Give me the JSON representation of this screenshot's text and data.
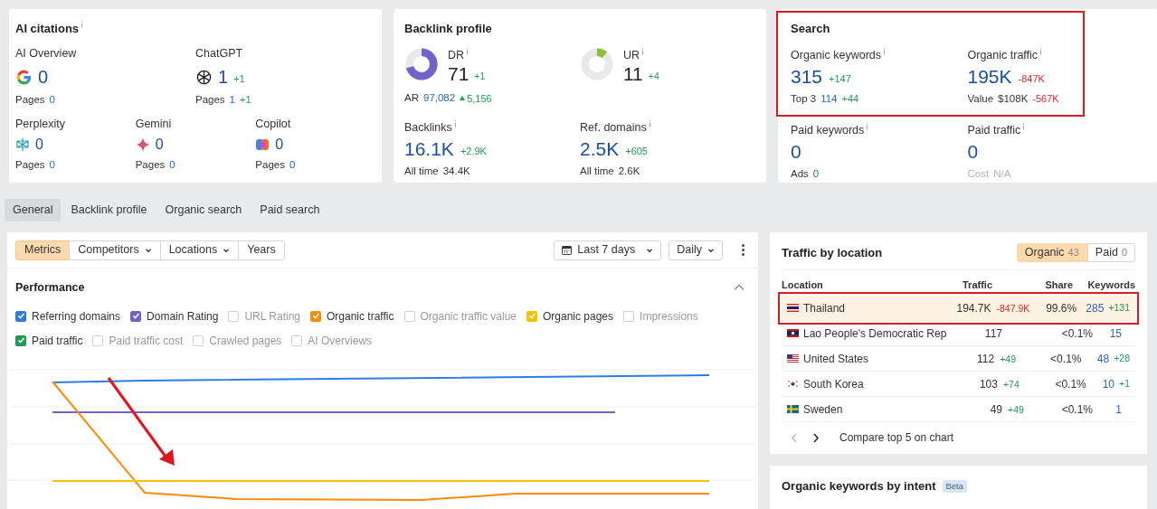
{
  "ai_citations": {
    "title": "AI citations",
    "rows": [
      [
        {
          "kind": "google",
          "name": "AI Overview",
          "value": "0",
          "pages_label": "Pages",
          "pages": "0"
        },
        {
          "kind": "chatgpt",
          "name": "ChatGPT",
          "value": "1",
          "delta": "+1",
          "pages_label": "Pages",
          "pages": "1",
          "pages_delta": "+1"
        }
      ],
      [
        {
          "kind": "perplexity",
          "name": "Perplexity",
          "value": "0",
          "pages_label": "Pages",
          "pages": "0"
        },
        {
          "kind": "gemini",
          "name": "Gemini",
          "value": "0",
          "pages_label": "Pages",
          "pages": "0"
        },
        {
          "kind": "copilot",
          "name": "Copilot",
          "value": "0",
          "pages_label": "Pages",
          "pages": "0"
        }
      ]
    ]
  },
  "backlink_profile": {
    "title": "Backlink profile",
    "ratings": [
      {
        "kind": "dr",
        "label": "DR",
        "value": "71",
        "delta": "+1",
        "ar_label": "AR",
        "ar_value": "97,082",
        "ar_delta": "5,156"
      },
      {
        "kind": "ur",
        "label": "UR",
        "value": "11",
        "delta": "+4"
      }
    ],
    "stats": [
      {
        "label": "Backlinks",
        "value": "16.1K",
        "delta": "+2.9K",
        "sub_label": "All time",
        "sub_value": "34.4K"
      },
      {
        "label": "Ref. domains",
        "value": "2.5K",
        "delta": "+605",
        "sub_label": "All time",
        "sub_value": "2.6K"
      }
    ]
  },
  "search": {
    "title": "Search",
    "highlighted": true,
    "organic": [
      {
        "label": "Organic keywords",
        "value": "315",
        "delta": "+147",
        "negative": false,
        "sub_label": "Top 3",
        "sub_value": "114",
        "sub_value_link": true,
        "sub_delta": "+44",
        "sub_negative": false
      },
      {
        "label": "Organic traffic",
        "value": "195K",
        "delta": "-847K",
        "negative": true,
        "sub_label": "Value",
        "sub_value": "$108K",
        "sub_value_link": false,
        "sub_delta": "-567K",
        "sub_negative": true
      }
    ],
    "paid": [
      {
        "label": "Paid keywords",
        "value": "0",
        "sub_label": "Ads",
        "sub_value": "0",
        "disabled": false
      },
      {
        "label": "Paid traffic",
        "value": "0",
        "sub_label": "Cost",
        "sub_value": "N/A",
        "disabled": true
      }
    ]
  },
  "tabs": [
    {
      "label": "General",
      "selected": true
    },
    {
      "label": "Backlink profile",
      "selected": false
    },
    {
      "label": "Organic search",
      "selected": false
    },
    {
      "label": "Paid search",
      "selected": false
    }
  ],
  "toolbar": {
    "segments": [
      {
        "label": "Metrics",
        "selected": true,
        "dropdown": false
      },
      {
        "label": "Competitors",
        "selected": false,
        "dropdown": true
      },
      {
        "label": "Locations",
        "selected": false,
        "dropdown": true
      },
      {
        "label": "Years",
        "selected": false,
        "dropdown": false
      }
    ],
    "period": "Last 7 days",
    "interval": "Daily"
  },
  "performance": {
    "title": "Performance",
    "expanded": true,
    "series": [
      {
        "label": "Referring domains",
        "checked": true,
        "color": "#2d7ee0"
      },
      {
        "label": "Domain Rating",
        "checked": true,
        "color": "#7262c9"
      },
      {
        "label": "URL Rating",
        "checked": false
      },
      {
        "label": "Organic traffic",
        "checked": true,
        "color": "#ff8a0a"
      },
      {
        "label": "Organic traffic value",
        "checked": false
      },
      {
        "label": "Organic pages",
        "checked": true,
        "color": "#f8c200"
      },
      {
        "label": "Impressions",
        "checked": false
      },
      {
        "label": "Paid traffic",
        "checked": true,
        "color": "#1e9b52"
      },
      {
        "label": "Paid traffic cost",
        "checked": false
      },
      {
        "label": "Crawled pages",
        "checked": false
      },
      {
        "label": "AI Overviews",
        "checked": false
      }
    ]
  },
  "traffic_by_location": {
    "title": "Traffic by location",
    "filters": [
      {
        "label": "Organic",
        "count": "43",
        "selected": true
      },
      {
        "label": "Paid",
        "count": "0",
        "selected": false
      }
    ],
    "columns": [
      "Location",
      "Traffic",
      "Share",
      "Keywords"
    ],
    "rows": [
      {
        "kind": "th",
        "location": "Thailand",
        "traffic": "194.7K",
        "traffic_delta": "-847.9K",
        "negative": true,
        "share": "99.6%",
        "keywords": "285",
        "keywords_delta": "+131",
        "highlighted": true
      },
      {
        "kind": "la",
        "location": "Lao People's Democratic Rep",
        "traffic": "117",
        "share": "<0.1%",
        "keywords": "15",
        "highlighted": false
      },
      {
        "kind": "us",
        "location": "United States",
        "traffic": "112",
        "traffic_delta": "+49",
        "negative": false,
        "share": "<0.1%",
        "keywords": "48",
        "keywords_delta": "+28",
        "highlighted": false
      },
      {
        "kind": "kr",
        "location": "South Korea",
        "traffic": "103",
        "traffic_delta": "+74",
        "negative": false,
        "share": "<0.1%",
        "keywords": "10",
        "keywords_delta": "+1",
        "highlighted": false
      },
      {
        "kind": "se",
        "location": "Sweden",
        "traffic": "49",
        "traffic_delta": "+49",
        "negative": false,
        "share": "<0.1%",
        "keywords": "1",
        "highlighted": false
      }
    ],
    "pager": {
      "prev_disabled": true,
      "next_disabled": false,
      "compare": "Compare top 5 on chart"
    }
  },
  "intent": {
    "title": "Organic keywords by intent",
    "badge": "Beta"
  }
}
